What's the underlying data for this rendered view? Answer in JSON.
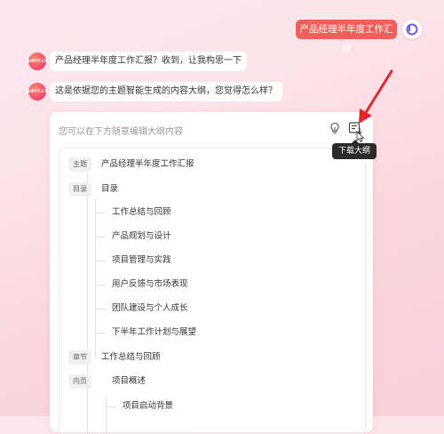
{
  "user_message": "产品经理半年度工作汇报",
  "bot_logo_text": "AIPPT.CN",
  "bot_messages": [
    "产品经理半年度工作汇报？收到，让我构思一下",
    "这是依据您的主题智能生成的内容大纲，您觉得怎么样？"
  ],
  "panel": {
    "hint": "您可以在下方随意编辑大纲内容",
    "bulb_icon": "lightbulb-icon",
    "download_icon": "download-outline-icon",
    "tooltip": "下载大纲"
  },
  "outline": {
    "topic_tag": "主题",
    "topic": "产品经理半年度工作汇报",
    "toc_tag": "目录",
    "toc": "目录",
    "toc_items": [
      "工作总结与回顾",
      "产品规划与设计",
      "项目管理与实践",
      "用户反馈与市场表现",
      "团队建设与个人成长",
      "下半年工作计划与展望"
    ],
    "chapter_tag": "章节",
    "chapter": "工作总结与回顾",
    "page_tag": "内页",
    "page": "项目概述",
    "sub_item": "项目启动背景"
  },
  "colors": {
    "accent": "#f0605a",
    "annotation_arrow": "#e5262e"
  }
}
